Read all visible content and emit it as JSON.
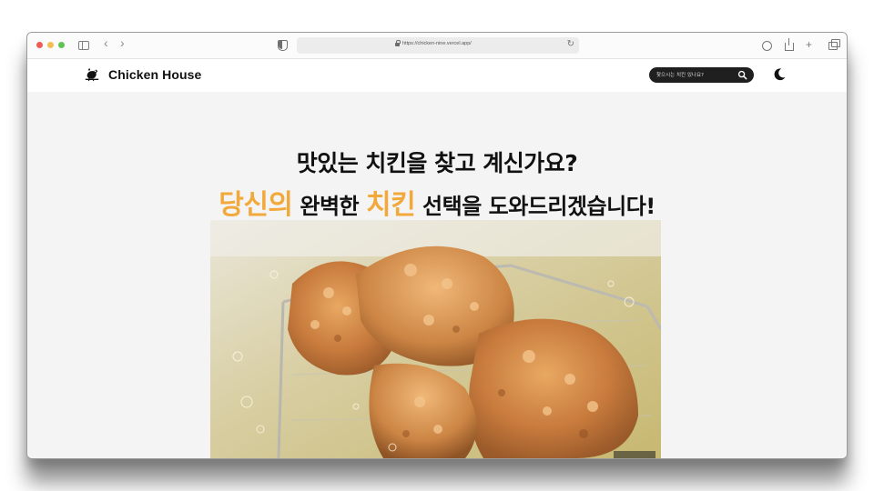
{
  "browser": {
    "url": "https://chicken-nine.vercel.app/"
  },
  "header": {
    "logo_text": "Chicken House",
    "logo_icon": "chicken-icon",
    "search_placeholder": "찾으시는 치킨 있나요?",
    "search_icon": "search-icon",
    "theme_toggle_icon": "moon-icon"
  },
  "hero": {
    "line1": "맛있는 치킨을 찾고 계신가요?",
    "line2": {
      "accent1": "당신의",
      "text1": " 완벽한 ",
      "accent2": "치킨",
      "text2": " 선택을 도와드리겠습니다!"
    },
    "image_alt": "fried chicken in fryer basket",
    "image_caption": ""
  },
  "colors": {
    "accent": "#f2a93b",
    "text": "#111111",
    "search_bg": "#1f1f1f",
    "page_bg": "#f4f4f4"
  }
}
